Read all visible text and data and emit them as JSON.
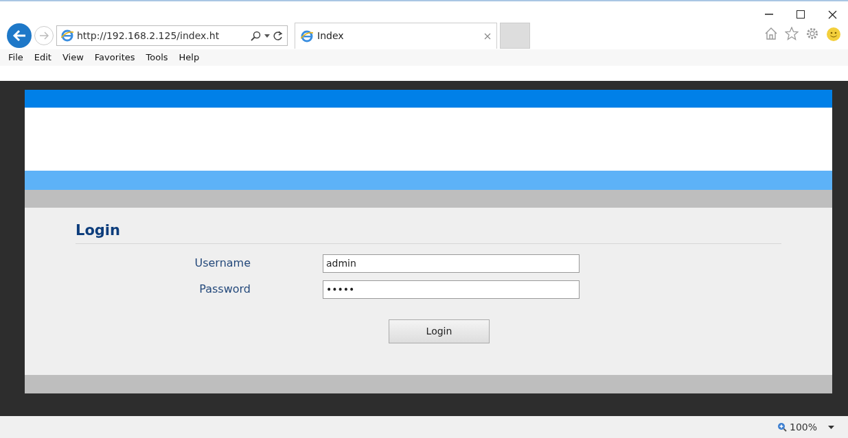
{
  "browser": {
    "address": "http://192.168.2.125/index.ht",
    "tabs": [
      {
        "title": "Index",
        "selected": true
      }
    ],
    "menu": [
      "File",
      "Edit",
      "View",
      "Favorites",
      "Tools",
      "Help"
    ],
    "zoom": "100%"
  },
  "login": {
    "title": "Login",
    "fields": [
      {
        "label": "Username",
        "value": "admin"
      },
      {
        "label": "Password",
        "value": "•••••"
      }
    ],
    "button": "Login"
  }
}
